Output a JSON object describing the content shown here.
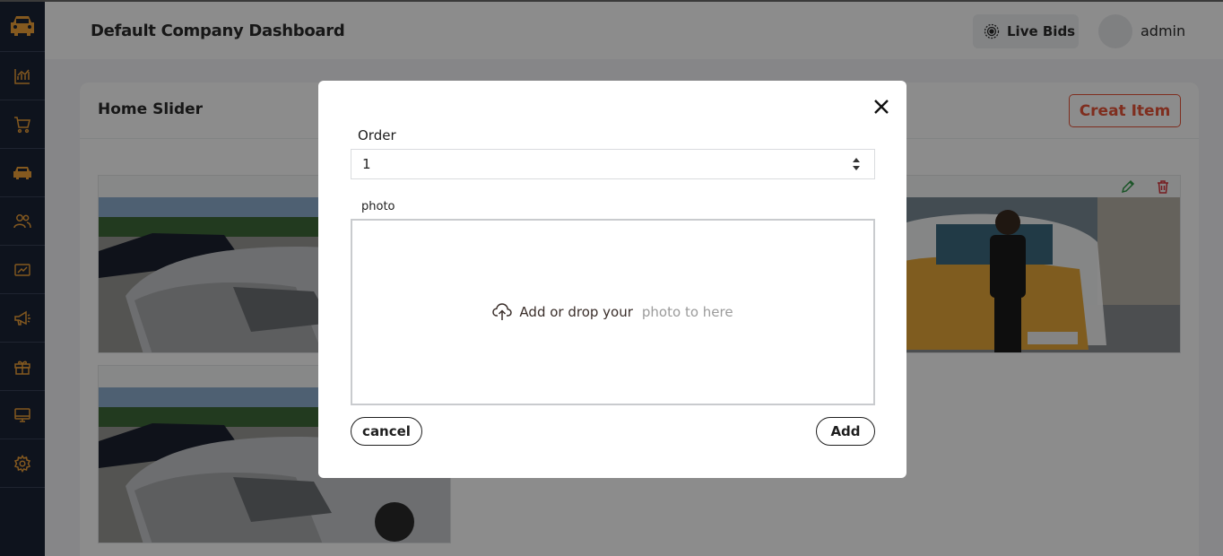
{
  "header": {
    "title": "Default Company Dashboard",
    "live_bids_label": "Live Bids",
    "user_name": "admin"
  },
  "sidebar": {
    "items": [
      {
        "icon": "car-logo-icon"
      },
      {
        "icon": "chart-icon"
      },
      {
        "icon": "cart-icon"
      },
      {
        "icon": "car-icon"
      },
      {
        "icon": "users-icon"
      },
      {
        "icon": "report-icon"
      },
      {
        "icon": "megaphone-icon"
      },
      {
        "icon": "gift-icon"
      },
      {
        "icon": "monitor-icon"
      },
      {
        "icon": "gear-icon"
      }
    ],
    "accent": "#f0a23a"
  },
  "main": {
    "card_title": "Home Slider",
    "create_label": "Creat Item",
    "create_color": "#e8553a"
  },
  "modal": {
    "order_label": "Order",
    "order_value": "1",
    "photo_label": "photo",
    "drop_text": "Add or drop your",
    "drop_text_muted": "photo to here",
    "cancel_label": "cancel",
    "add_label": "Add"
  }
}
